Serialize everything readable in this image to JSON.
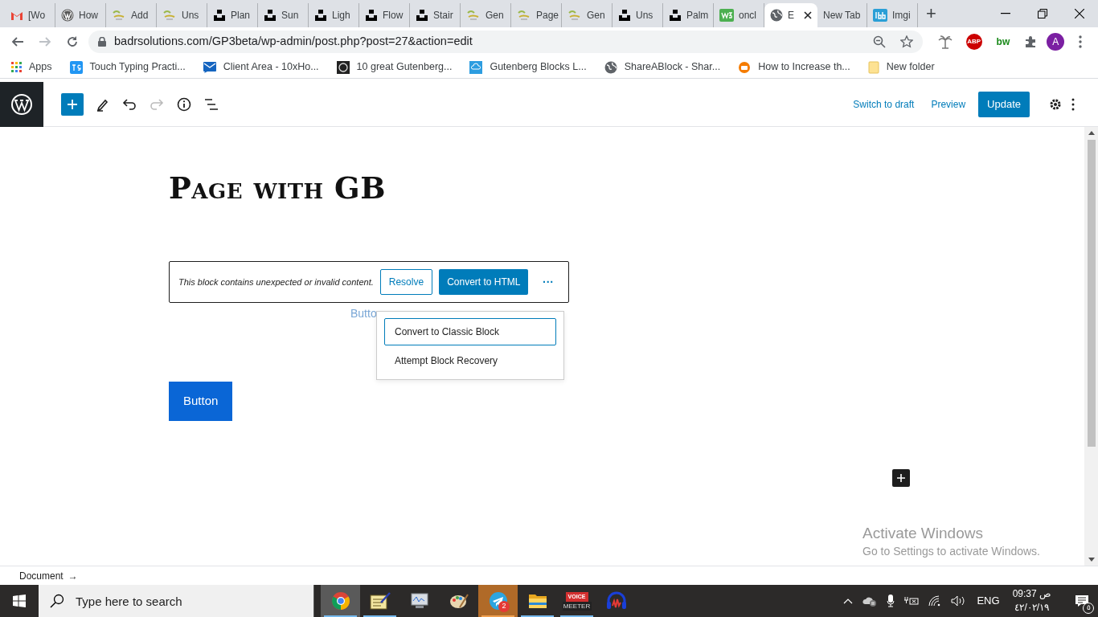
{
  "browser": {
    "tabs": [
      {
        "label": "[Wo",
        "kind": "gmail",
        "selected": false
      },
      {
        "label": "How",
        "kind": "wordpress",
        "selected": false
      },
      {
        "label": "Add",
        "kind": "badr",
        "selected": false
      },
      {
        "label": "Uns",
        "kind": "badr",
        "selected": false
      },
      {
        "label": "Plan",
        "kind": "unsplash",
        "selected": false
      },
      {
        "label": "Sun",
        "kind": "unsplash",
        "selected": false
      },
      {
        "label": "Ligh",
        "kind": "unsplash",
        "selected": false
      },
      {
        "label": "Flow",
        "kind": "unsplash",
        "selected": false
      },
      {
        "label": "Stair",
        "kind": "unsplash",
        "selected": false
      },
      {
        "label": "Gen",
        "kind": "badr",
        "selected": false
      },
      {
        "label": "Page",
        "kind": "badr",
        "selected": false
      },
      {
        "label": "Gen",
        "kind": "badr",
        "selected": false
      },
      {
        "label": "Uns",
        "kind": "unsplash",
        "selected": false
      },
      {
        "label": "Palm",
        "kind": "unsplash",
        "selected": false
      },
      {
        "label": "oncl",
        "kind": "w3",
        "selected": false
      },
      {
        "label": "E",
        "kind": "globe",
        "selected": true
      },
      {
        "label": "New Tab",
        "kind": "plain",
        "selected": false
      },
      {
        "label": "Imgi",
        "kind": "ibb",
        "selected": false
      }
    ],
    "new_tab": "+",
    "address": "badrsolutions.com/GP3beta/wp-admin/post.php?post=27&action=edit",
    "profile": "A",
    "extensions": [
      {
        "label": "ABP",
        "color": "#cc0000"
      },
      {
        "label": "bw",
        "color": "#1a8a1a"
      }
    ],
    "bookmarks": [
      {
        "label": "Apps",
        "kind": "apps"
      },
      {
        "label": "Touch Typing Practi...",
        "kind": "ts"
      },
      {
        "label": "Client Area - 10xHo...",
        "kind": "mail"
      },
      {
        "label": "10 great Gutenberg...",
        "kind": "dark"
      },
      {
        "label": "Gutenberg Blocks L...",
        "kind": "cloud"
      },
      {
        "label": "ShareABlock - Shar...",
        "kind": "globe"
      },
      {
        "label": "How to Increase th...",
        "kind": "orange"
      },
      {
        "label": "New folder",
        "kind": "folder"
      }
    ]
  },
  "editor": {
    "toolbar": {
      "switch_to_draft": "Switch to draft",
      "preview": "Preview",
      "update": "Update",
      "redo_disabled": true
    },
    "title": "Page with GB",
    "invalid_block": {
      "message": "This block contains unexpected or invalid content.",
      "resolve": "Resolve",
      "convert": "Convert to HTML",
      "more": "···"
    },
    "hidden_text": "Butto",
    "menu": [
      {
        "label": "Convert to Classic Block",
        "selected": true
      },
      {
        "label": "Attempt Block Recovery",
        "selected": false
      }
    ],
    "button": "Button",
    "breadcrumb": "Document",
    "breadcrumb_arrow": "→"
  },
  "activation": {
    "title": "Activate Windows",
    "subtitle": "Go to Settings to activate Windows."
  },
  "taskbar": {
    "search_placeholder": "Type here to search",
    "apps": [
      {
        "kind": "chrome",
        "running": true,
        "active": true
      },
      {
        "kind": "notes",
        "running": true,
        "active": false
      },
      {
        "kind": "monitor",
        "running": false,
        "active": false
      },
      {
        "kind": "paint",
        "running": false,
        "active": false
      },
      {
        "kind": "telegram",
        "running": true,
        "active": true,
        "badge": "2"
      },
      {
        "kind": "folder",
        "running": true,
        "active": false
      },
      {
        "kind": "voicemeeter",
        "running": true,
        "active": false,
        "label_top": "VOICE",
        "label_bottom": "MEETER"
      },
      {
        "kind": "audio",
        "running": false,
        "active": false
      }
    ],
    "language": "ENG",
    "time": "09:37 ص",
    "date": "٤٢/٠٢/١٩",
    "notifications": "٥"
  }
}
